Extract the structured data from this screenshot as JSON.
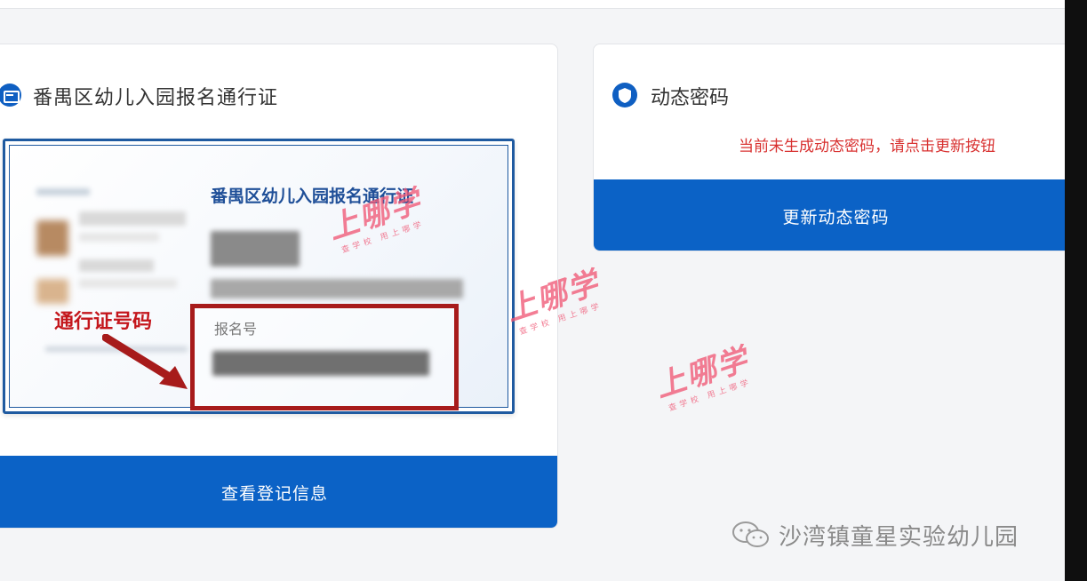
{
  "colors": {
    "primary": "#0b62c6",
    "annotation_red": "#a71b1b",
    "status_red": "#d8302f",
    "watermark_pink": "#f05876"
  },
  "pass_card": {
    "title": "番禺区幼儿入园报名通行证",
    "icon": "id-card-icon",
    "pass_image": {
      "title": "番禺区幼儿入园报名通行证",
      "annotation_label": "通行证号码",
      "reg_number_label": "报名号"
    },
    "view_button": "查看登记信息"
  },
  "dynamic_password": {
    "title": "动态密码",
    "icon": "shield-icon",
    "status_message": "当前未生成动态密码，请点击更新按钮",
    "refresh_button": "更新动态密码"
  },
  "watermark": {
    "brand": "上哪学",
    "sub": "查学校 用上哪学"
  },
  "account_watermark": {
    "icon": "wechat-icon",
    "name": "沙湾镇童星实验幼儿园"
  }
}
